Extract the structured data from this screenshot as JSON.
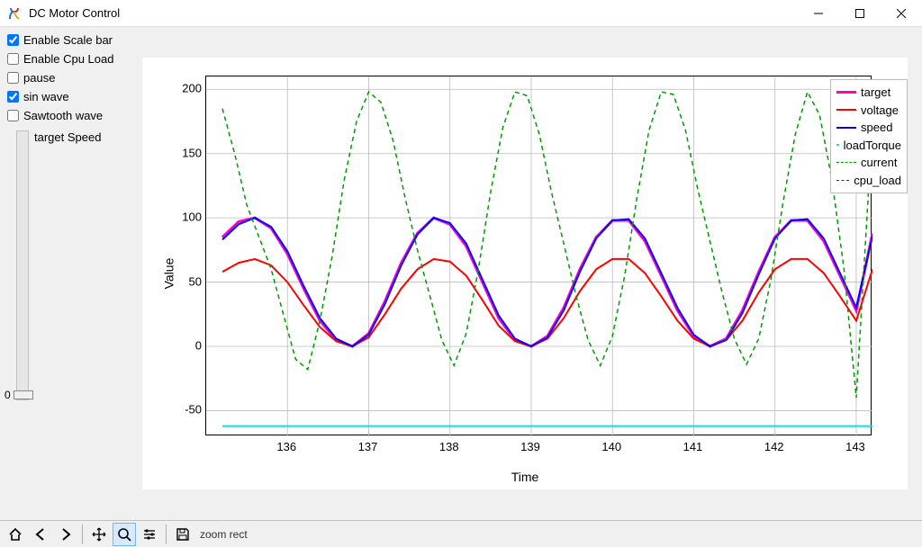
{
  "window": {
    "title": "DC Motor Control",
    "minimize_tooltip": "Minimize",
    "maximize_tooltip": "Maximize",
    "close_tooltip": "Close"
  },
  "sidebar": {
    "options": [
      {
        "label": "Enable Scale bar",
        "checked": true
      },
      {
        "label": "Enable Cpu Load",
        "checked": false
      },
      {
        "label": "pause",
        "checked": false
      },
      {
        "label": "sin wave",
        "checked": true
      },
      {
        "label": "Sawtooth wave",
        "checked": false
      }
    ],
    "slider": {
      "label": "target Speed",
      "value": "0"
    }
  },
  "toolbar": {
    "home": "Home",
    "back": "Back",
    "forward": "Forward",
    "pan": "Pan",
    "zoom": "Zoom",
    "subplots": "Configure subplots",
    "save": "Save",
    "status": "zoom rect"
  },
  "chart_data": {
    "type": "line",
    "xlabel": "Time",
    "ylabel": "Value",
    "xlim": [
      135,
      143.2
    ],
    "ylim": [
      -70,
      210
    ],
    "xticks": [
      136,
      137,
      138,
      139,
      140,
      141,
      142,
      143
    ],
    "yticks": [
      -50,
      0,
      50,
      100,
      150,
      200
    ],
    "legend_position": "upper-right",
    "series": [
      {
        "name": "target",
        "color": "#ff00c8",
        "style": "solid",
        "width": 3,
        "x": [
          135.2,
          135.4,
          135.6,
          135.8,
          136.0,
          136.2,
          136.4,
          136.6,
          136.8,
          137.0,
          137.2,
          137.4,
          137.6,
          137.8,
          138.0,
          138.2,
          138.4,
          138.6,
          138.8,
          139.0,
          139.2,
          139.4,
          139.6,
          139.8,
          140.0,
          140.2,
          140.4,
          140.6,
          140.8,
          141.0,
          141.2,
          141.4,
          141.6,
          141.8,
          142.0,
          142.2,
          142.4,
          142.6,
          142.8,
          143.0,
          143.2
        ],
        "y": [
          85,
          97,
          100,
          92,
          72,
          45,
          20,
          5,
          0,
          10,
          35,
          65,
          88,
          100,
          95,
          78,
          50,
          22,
          5,
          0,
          8,
          30,
          60,
          85,
          98,
          98,
          82,
          55,
          28,
          8,
          0,
          6,
          28,
          58,
          85,
          98,
          98,
          82,
          55,
          28,
          88
        ]
      },
      {
        "name": "voltage",
        "color": "#ff0000",
        "style": "solid",
        "width": 2,
        "x": [
          135.2,
          135.4,
          135.6,
          135.8,
          136.0,
          136.2,
          136.4,
          136.6,
          136.8,
          137.0,
          137.2,
          137.4,
          137.6,
          137.8,
          138.0,
          138.2,
          138.4,
          138.6,
          138.8,
          139.0,
          139.2,
          139.4,
          139.6,
          139.8,
          140.0,
          140.2,
          140.4,
          140.6,
          140.8,
          141.0,
          141.2,
          141.4,
          141.6,
          141.8,
          142.0,
          142.2,
          142.4,
          142.6,
          142.8,
          143.0,
          143.2
        ],
        "y": [
          58,
          65,
          68,
          63,
          50,
          32,
          15,
          4,
          0,
          7,
          25,
          45,
          60,
          68,
          66,
          55,
          36,
          16,
          4,
          0,
          6,
          22,
          43,
          60,
          68,
          68,
          57,
          39,
          20,
          6,
          0,
          5,
          20,
          42,
          60,
          68,
          68,
          57,
          39,
          20,
          60
        ]
      },
      {
        "name": "speed",
        "color": "#0000ff",
        "style": "solid",
        "width": 2,
        "x": [
          135.2,
          135.4,
          135.6,
          135.8,
          136.0,
          136.2,
          136.4,
          136.6,
          136.8,
          137.0,
          137.2,
          137.4,
          137.6,
          137.8,
          138.0,
          138.2,
          138.4,
          138.6,
          138.8,
          139.0,
          139.2,
          139.4,
          139.6,
          139.8,
          140.0,
          140.2,
          140.4,
          140.6,
          140.8,
          141.0,
          141.2,
          141.4,
          141.6,
          141.8,
          142.0,
          142.2,
          142.4,
          142.6,
          142.8,
          143.0,
          143.2
        ],
        "y": [
          83,
          95,
          100,
          93,
          74,
          47,
          22,
          6,
          0,
          9,
          33,
          63,
          87,
          100,
          96,
          80,
          52,
          24,
          6,
          0,
          7,
          28,
          58,
          84,
          98,
          99,
          84,
          57,
          30,
          9,
          0,
          5,
          26,
          56,
          84,
          98,
          99,
          84,
          57,
          30,
          86
        ]
      },
      {
        "name": "loadTorque",
        "color": "#00e5e5",
        "style": "solid",
        "width": 2,
        "x": [
          135.2,
          143.2
        ],
        "y": [
          -62,
          -62
        ]
      },
      {
        "name": "current",
        "color": "#009a00",
        "style": "dashed",
        "width": 1.5,
        "x": [
          135.2,
          135.35,
          135.5,
          135.65,
          135.8,
          135.95,
          136.1,
          136.25,
          136.4,
          136.55,
          136.7,
          136.85,
          137.0,
          137.15,
          137.3,
          137.45,
          137.6,
          137.75,
          137.9,
          138.05,
          138.2,
          138.35,
          138.5,
          138.65,
          138.8,
          138.95,
          139.1,
          139.25,
          139.4,
          139.55,
          139.7,
          139.85,
          140.0,
          140.15,
          140.3,
          140.45,
          140.6,
          140.75,
          140.9,
          141.05,
          141.2,
          141.35,
          141.5,
          141.65,
          141.8,
          141.95,
          142.1,
          142.25,
          142.4,
          142.55,
          142.7,
          142.85,
          143.0,
          143.15
        ],
        "y": [
          185,
          150,
          110,
          85,
          60,
          25,
          -10,
          -18,
          20,
          70,
          130,
          175,
          198,
          190,
          160,
          115,
          75,
          40,
          5,
          -15,
          10,
          60,
          120,
          170,
          198,
          195,
          165,
          120,
          80,
          40,
          5,
          -15,
          8,
          55,
          115,
          168,
          198,
          196,
          168,
          122,
          82,
          42,
          6,
          -14,
          6,
          52,
          112,
          165,
          198,
          180,
          130,
          60,
          -40,
          120
        ]
      },
      {
        "name": "cpu_load",
        "color": "#333333",
        "style": "dashed",
        "width": 1,
        "x": [],
        "y": []
      }
    ]
  }
}
